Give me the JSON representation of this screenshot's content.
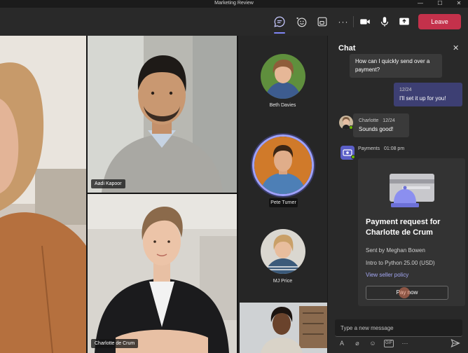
{
  "window": {
    "title": "Marketing Review"
  },
  "toolbar": {
    "leave_label": "Leave",
    "icons": [
      "chat-icon",
      "reactions-icon",
      "rooms-icon",
      "more-icon",
      "camera-icon",
      "mic-icon",
      "share-icon"
    ],
    "more_label": "···"
  },
  "stage": {
    "tiles": [
      {
        "name": "Aadi Kapoor"
      },
      {
        "name": "Charlotte de Crum"
      }
    ],
    "gallery": [
      {
        "name": "Beth Davies"
      },
      {
        "name": "Pete Turner"
      },
      {
        "name": "MJ Price"
      }
    ]
  },
  "chat": {
    "title": "Chat",
    "close": "✕",
    "messages": [
      {
        "text_1": "How can I quickly send over a",
        "text_2": "payment?"
      },
      {
        "time": "12/24",
        "text": "I'll set it up for you!"
      },
      {
        "sender": "Charlotte",
        "time": "12/24",
        "text": "Sounds good!"
      }
    ],
    "payments": {
      "sender": "Payments",
      "time": "01:08 pm",
      "title_1": "Payment request for",
      "title_2": "Charlotte de Crum",
      "sent_by": "Sent by Meghan Bowen",
      "item": "Intro to Python  25.00 (USD)",
      "link": "View seller policy",
      "pay_label": "Pay now"
    },
    "compose_placeholder": "Type a new message",
    "format_icons": [
      "format-icon",
      "attach-icon",
      "emoji-icon",
      "gif-icon",
      "more-options-icon"
    ],
    "format_glyphs": {
      "format": "A",
      "attach": "⌀",
      "emoji": "☺",
      "gif": "GIF",
      "more": "···"
    }
  },
  "colors": {
    "accent": "#7f85f5",
    "leave": "#c4314b",
    "online": "#6bb700"
  }
}
